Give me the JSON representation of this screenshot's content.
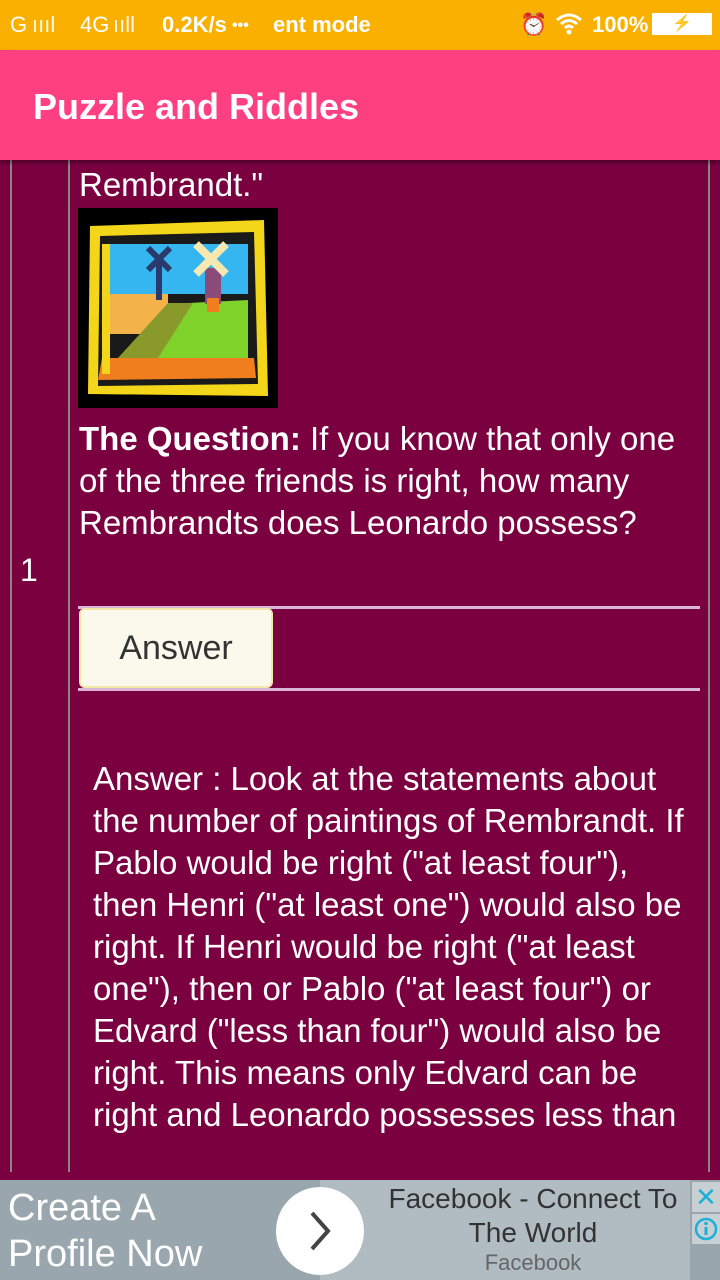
{
  "status_bar": {
    "signal1": "G",
    "signal2": "4G",
    "net_speed": "0.2K/s",
    "dots": "•••",
    "notification_text": "ent mode",
    "battery": "100%"
  },
  "app_bar": {
    "title": "Puzzle and Riddles"
  },
  "puzzle": {
    "row_number": "1",
    "quote_end": "Rembrandt.\"",
    "question_label": "The Question:",
    "question_text": " If you know that only one of the three friends is right, how many Rembrandts does Leonardo possess?",
    "answer_button": "Answer",
    "answer_text": "Answer : Look at the statements about the number of paintings of Rembrandt. If Pablo would be right (\"at least four\"), then Henri (\"at least one\") would also be right. If Henri would be right (\"at least one\"), then or Pablo (\"at least four\") or Edvard (\"less than four\") would also be right. This means only Edvard can be right and Leonardo possesses less than"
  },
  "ad": {
    "headline": "Create A Profile Now",
    "title": "Facebook - Connect To The World",
    "advertiser": "Facebook",
    "close_symbol": "✕"
  },
  "colors": {
    "status_bar": "#f9b000",
    "app_bar": "#ff4080",
    "background": "#7b0040",
    "button": "#fbf8ec"
  }
}
